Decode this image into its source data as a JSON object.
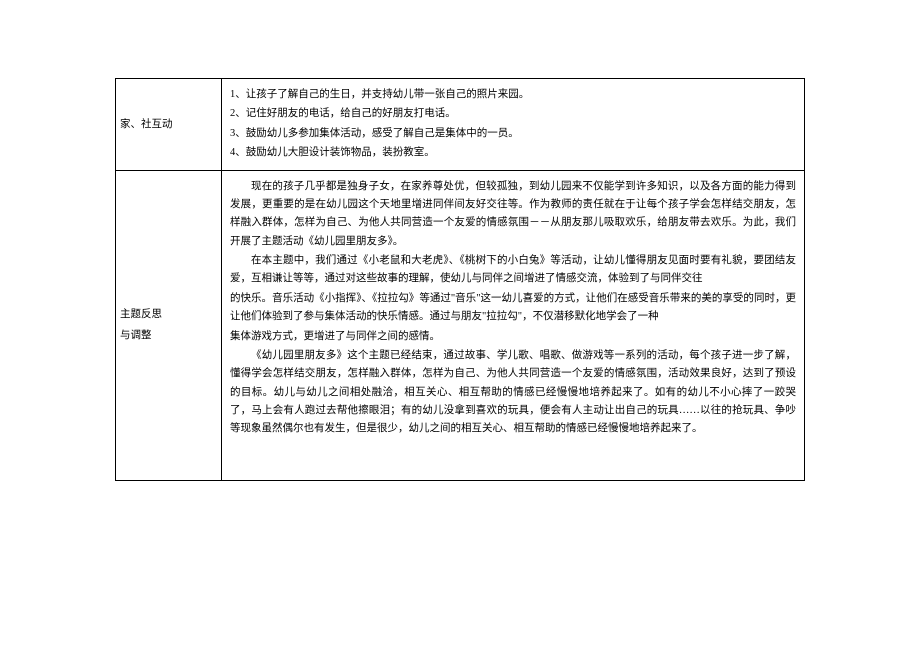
{
  "rows": [
    {
      "label": "家、社互动",
      "labelLines": [
        "家、社互动"
      ],
      "content": {
        "items": [
          "1、让孩子了解自己的生日，并支持幼儿带一张自己的照片来园。",
          "2、记住好朋友的电话，给自己的好朋友打电话。",
          "3、鼓励幼儿多参加集体活动，感受了解自己是集体中的一员。",
          "4、鼓励幼儿大胆设计装饰物品，装扮教室。"
        ]
      }
    },
    {
      "label": "主题反思与调整",
      "labelLines": [
        "主题反思",
        "与调整"
      ],
      "content": {
        "paragraphs": [
          {
            "text": "现在的孩子几乎都是独身子女，在家养尊处优，但较孤独，到幼儿园来不仅能学到许多知识，以及各方面的能力得到发展，更重要的是在幼儿园这个天地里增进同伴间友好交往等。作为教师的责任就在于让每个孩子学会怎样结交朋友，怎样融入群体，怎样为自己、为他人共同营造一个友爱的情感氛围－－从朋友那儿吸取欢乐，给朋友带去欢乐。为此，我们开展了主题活动《幼儿园里朋友多》。",
            "indent": true
          },
          {
            "text": "在本主题中，我们通过《小老鼠和大老虎》、《桃树下的小白兔》等活动，让幼儿懂得朋友见面时要有礼貌，要团结友爱，互相谦让等等，通过对这些故事的理解，使幼儿与同伴之间增进了情感交流，体验到了与同伴交往",
            "indent": true
          },
          {
            "text": "的快乐。音乐活动《小指挥》、《拉拉勾》等通过\"音乐\"这一幼儿喜爱的方式，让他们在感受音乐带来的美的享受的同时，更让他们体验到了参与集体活动的快乐情感。通过与朋友\"拉拉勾\"，不仅潜移默化地学会了一种",
            "indent": false
          },
          {
            "text": "集体游戏方式，更增进了与同伴之间的感情。",
            "indent": false
          },
          {
            "text": "《幼儿园里朋友多》这个主题已经结束，通过故事、学儿歌、唱歌、做游戏等一系列的活动，每个孩子进一步了解，懂得学会怎样结交朋友，怎样融入群体，怎样为自己、为他人共同营造一个友爱的情感氛围，活动效果良好，达到了预设的目标。幼儿与幼儿之间相处融洽，相互关心、相互帮助的情感已经慢慢地培养起来了。如有的幼儿不小心摔了一跤哭了，马上会有人跑过去帮他擦眼泪；有的幼儿没拿到喜欢的玩具，便会有人主动让出自己的玩具……以往的抢玩具、争吵等现象虽然偶尔也有发生，但是很少，幼儿之间的相互关心、相互帮助的情感已经慢慢地培养起来了。",
            "indent": true
          }
        ]
      }
    }
  ]
}
